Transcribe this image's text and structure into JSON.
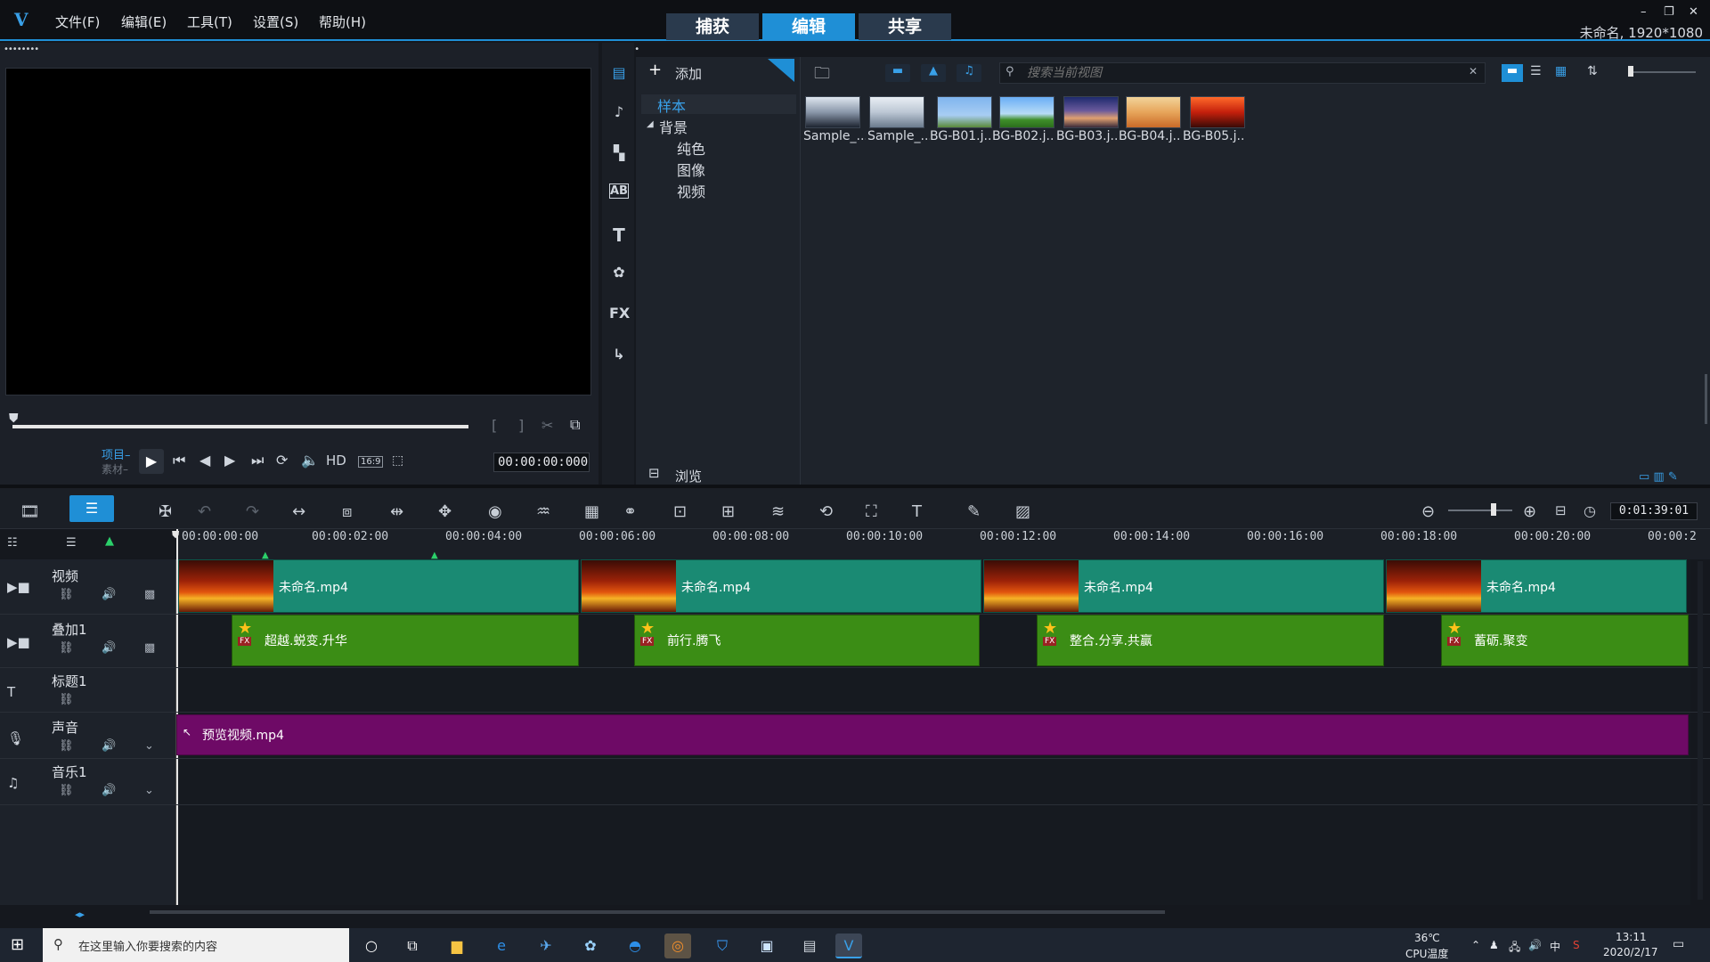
{
  "app": {
    "logo": "V",
    "menus": [
      "文件(F)",
      "编辑(E)",
      "工具(T)",
      "设置(S)",
      "帮助(H)"
    ],
    "mode_tabs": [
      "捕获",
      "编辑",
      "共享"
    ],
    "active_mode": "编辑",
    "window_controls": [
      "–",
      "❐",
      "✕"
    ],
    "project_info": "未命名, 1920*1080",
    "accent": "#1f8fd6"
  },
  "preview": {
    "project_label": "项目–",
    "clip_label": "素材–",
    "hd_label": "HD",
    "aspect_label": "16:9",
    "timecode": "00:00:00:000"
  },
  "library": {
    "add_label": "添加",
    "browse_label": "浏览",
    "search_placeholder": "搜索当前视图",
    "tree": {
      "sample": "样本",
      "background": "背景",
      "children": [
        "纯色",
        "图像",
        "视频"
      ]
    },
    "thumbnails": [
      "Sample_...",
      "Sample_...",
      "BG-B01.j...",
      "BG-B02.j...",
      "BG-B03.j...",
      "BG-B04.j...",
      "BG-B05.j..."
    ],
    "side_icons": [
      "media-icon",
      "music-icon",
      "transition-icon",
      "title-icon",
      "text-icon",
      "graphics-icon",
      "fx-icon",
      "path-icon"
    ],
    "fx_label": "FX",
    "ab_label": "AB",
    "t_label": "T"
  },
  "timeline": {
    "duration": "0:01:39:01",
    "ruler": [
      "00:00:00:00",
      "00:00:02:00",
      "00:00:04:00",
      "00:00:06:00",
      "00:00:08:00",
      "00:00:10:00",
      "00:00:12:00",
      "00:00:14:00",
      "00:00:16:00",
      "00:00:18:00",
      "00:00:20:00",
      "00:00:2"
    ],
    "tracks": [
      "视频",
      "叠加1",
      "标题1",
      "声音",
      "音乐1"
    ],
    "video_clips": [
      "未命名.mp4",
      "未命名.mp4",
      "未命名.mp4",
      "未命名.mp4"
    ],
    "overlay_clips": [
      "超越.蜕变.升华",
      "前行.腾飞",
      "整合.分享.共赢",
      "蓄砺.聚变"
    ],
    "audio_clip": "预览视频.mp4",
    "fx_badge": "FX",
    "colors": {
      "video": "#1a8a73",
      "overlay": "#3b8d15",
      "audio": "#6e0a66"
    }
  },
  "taskbar": {
    "search_placeholder": "在这里输入你要搜索的内容",
    "temperature": "36℃",
    "cpu_label": "CPU温度",
    "ime": "中",
    "time": "13:11",
    "date": "2020/2/17"
  }
}
